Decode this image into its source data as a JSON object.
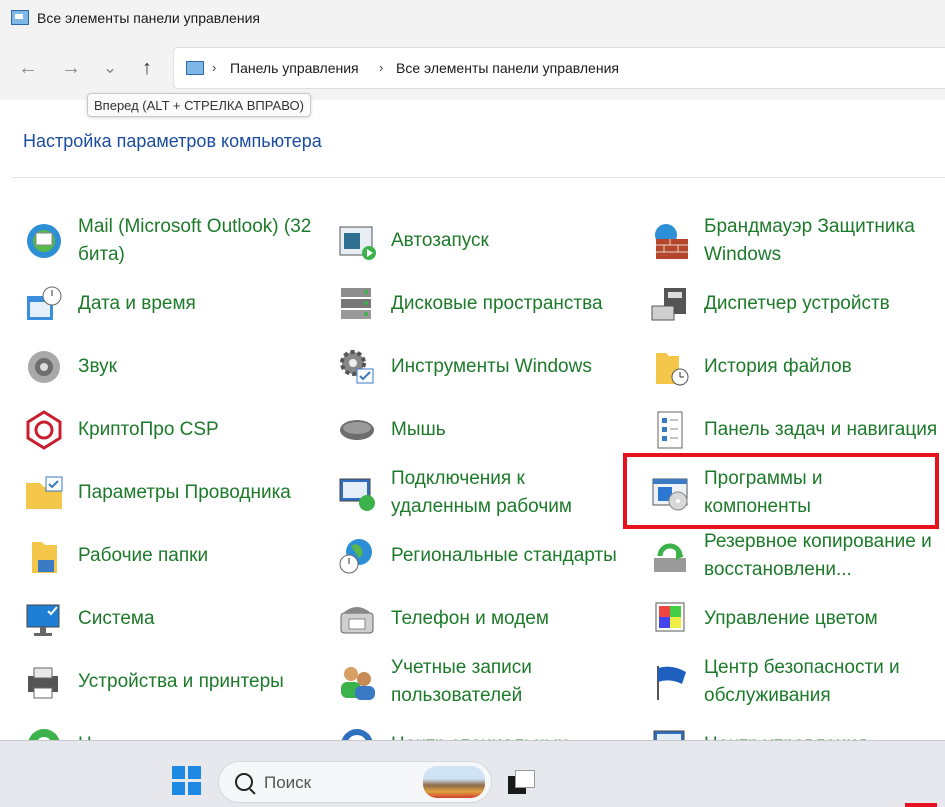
{
  "window": {
    "title": "Все элементы панели управления"
  },
  "nav": {
    "back_icon": "←",
    "forward_icon": "→",
    "recent_icon": "⌄",
    "up_icon": "↑",
    "breadcrumb": [
      "Панель управления",
      "Все элементы панели управления"
    ],
    "separator": "›",
    "tooltip": "Вперед (ALT + СТРЕЛКА ВПРАВО)"
  },
  "heading": "Настройка параметров компьютера",
  "items": [
    {
      "label": "Mail (Microsoft Outlook) (32 бита)",
      "icon": "mail-icon"
    },
    {
      "label": "Автозапуск",
      "icon": "autoplay-icon"
    },
    {
      "label": "Брандмауэр Защитника Windows",
      "icon": "firewall-icon"
    },
    {
      "label": "Дата и время",
      "icon": "datetime-icon"
    },
    {
      "label": "Дисковые пространства",
      "icon": "storage-spaces-icon"
    },
    {
      "label": "Диспетчер устройств",
      "icon": "device-manager-icon"
    },
    {
      "label": "Звук",
      "icon": "sound-icon"
    },
    {
      "label": "Инструменты Windows",
      "icon": "windows-tools-icon"
    },
    {
      "label": "История файлов",
      "icon": "file-history-icon"
    },
    {
      "label": "КриптоПро CSP",
      "icon": "cryptopro-icon"
    },
    {
      "label": "Мышь",
      "icon": "mouse-icon"
    },
    {
      "label": "Панель задач и навигация",
      "icon": "taskbar-icon"
    },
    {
      "label": "Параметры Проводника",
      "icon": "explorer-options-icon"
    },
    {
      "label": "Подключения к удаленным рабочим",
      "icon": "remote-desktop-icon"
    },
    {
      "label": "Программы и компоненты",
      "icon": "programs-icon"
    },
    {
      "label": "Рабочие папки",
      "icon": "work-folders-icon"
    },
    {
      "label": "Региональные стандарты",
      "icon": "region-icon"
    },
    {
      "label": "Резервное копирование и восстановлени...",
      "icon": "backup-icon"
    },
    {
      "label": "Система",
      "icon": "system-icon"
    },
    {
      "label": "Телефон и модем",
      "icon": "phone-modem-icon"
    },
    {
      "label": "Управление цветом",
      "icon": "color-management-icon"
    },
    {
      "label": "Устройства и принтеры",
      "icon": "devices-printers-icon"
    },
    {
      "label": "Учетные записи пользователей",
      "icon": "user-accounts-icon"
    },
    {
      "label": "Центр безопасности и обслуживания",
      "icon": "security-center-icon"
    },
    {
      "label": "Н",
      "icon": "partial-icon"
    },
    {
      "label": "Центр специальных",
      "icon": "ease-of-access-icon"
    },
    {
      "label": "Центр управления",
      "icon": "network-center-icon"
    }
  ],
  "taskbar": {
    "search_placeholder": "Поиск",
    "start_icon": "windows-logo-icon",
    "taskview_icon": "task-view-icon"
  }
}
